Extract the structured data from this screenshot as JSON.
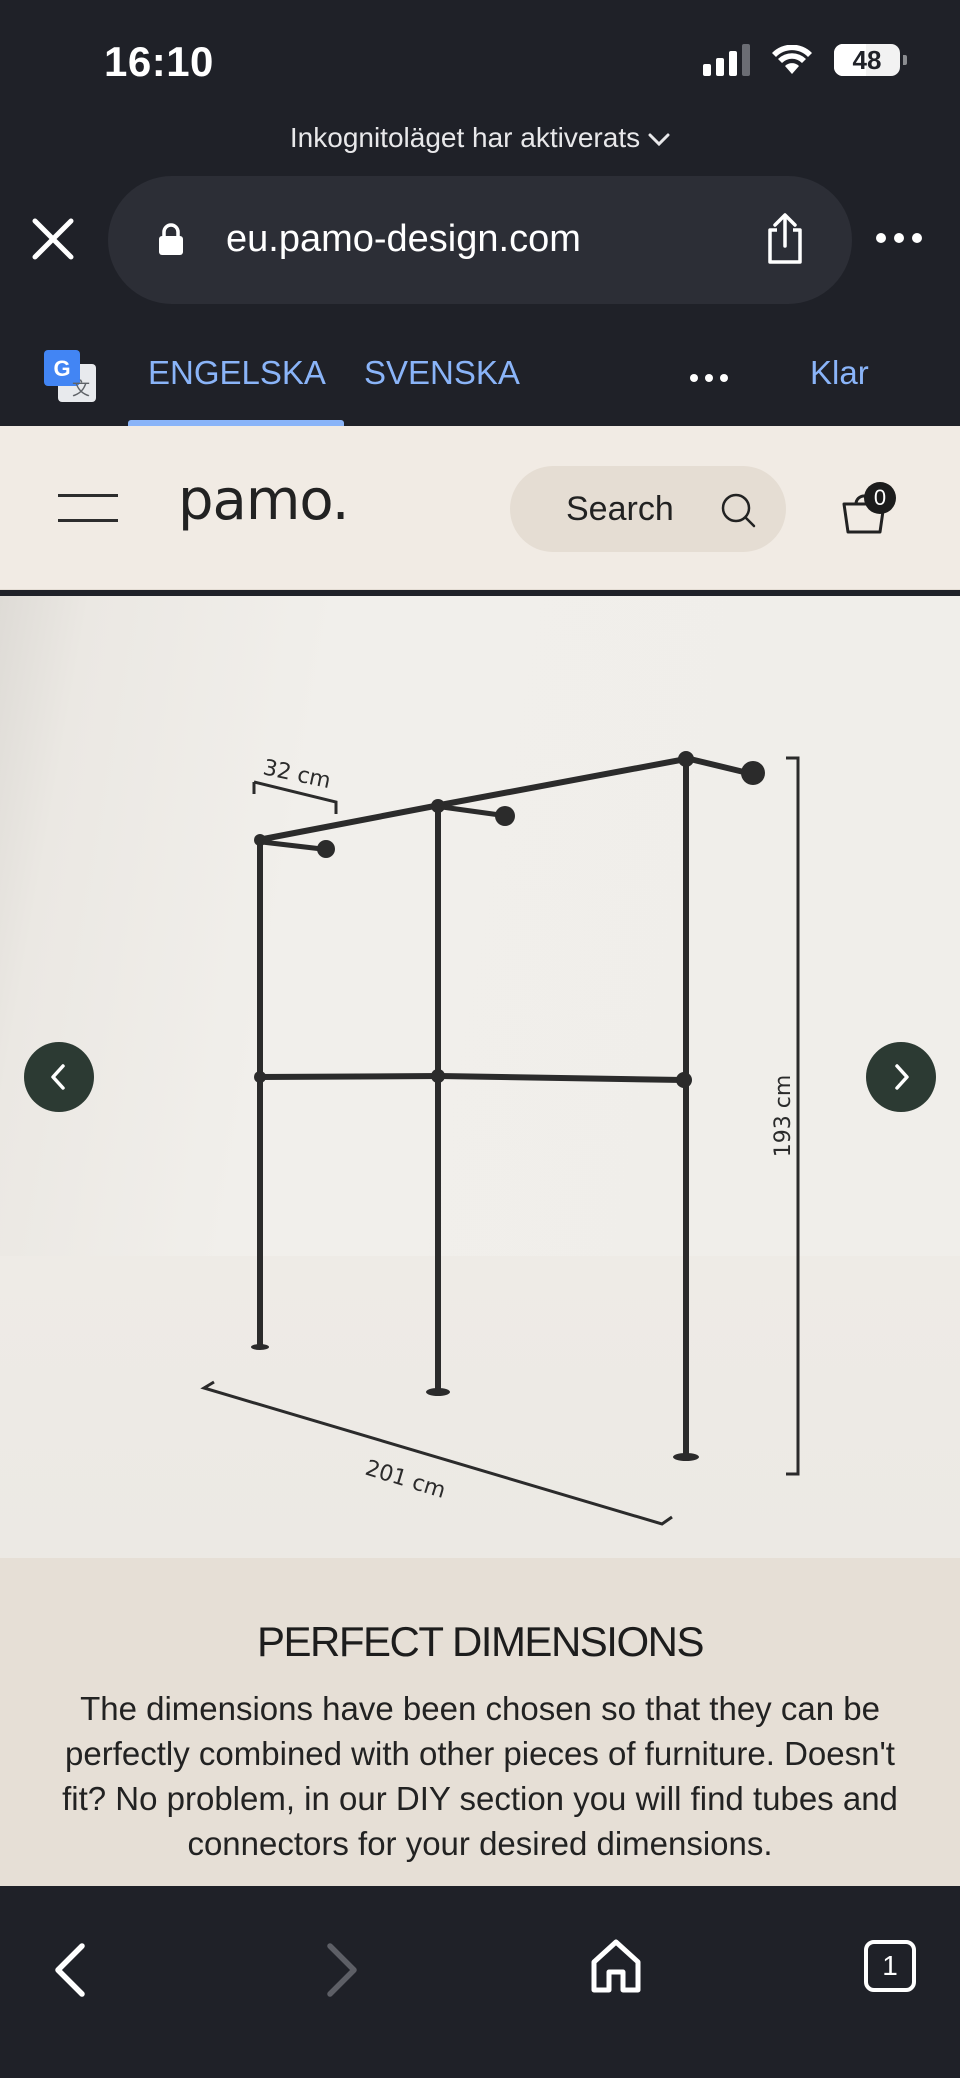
{
  "status_bar": {
    "time": "16:10",
    "battery": "48",
    "battery_level_percent": 48,
    "incognito_notice": "Inkognitoläget har aktiverats"
  },
  "browser": {
    "url": "eu.pamo-design.com",
    "icons": [
      "close-icon",
      "lock-icon",
      "share-icon",
      "more-icon"
    ]
  },
  "translate_bar": {
    "languages": [
      "ENGELSKA",
      "SVENSKA"
    ],
    "selected_language": "ENGELSKA",
    "done_label": "Klar",
    "accent_color": "#8ab4f8"
  },
  "site_header": {
    "logo": "pamo.",
    "search_placeholder": "Search",
    "cart_count": "0"
  },
  "product_image": {
    "dimension_depth": "32 cm",
    "dimension_height": "193 cm",
    "dimension_width": "201 cm"
  },
  "description": {
    "title": "PERFECT DIMENSIONS",
    "body": "The dimensions have been chosen so that they can be perfectly combined with other pieces of furniture. Doesn't fit? No problem, in our DIY section you will find tubes and connectors for your desired dimensions."
  },
  "bottom_bar": {
    "tab_count": "1"
  },
  "colors": {
    "browser_chrome": "#1f2128",
    "site_background": "#f1ebe4",
    "carousel_button": "#2c3a33"
  }
}
